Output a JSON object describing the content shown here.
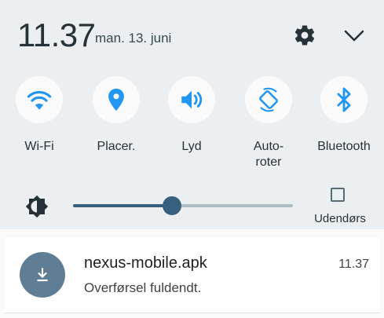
{
  "status": {
    "time": "11.37",
    "date": "man. 13. juni"
  },
  "header": {
    "settings_icon": "gear-icon",
    "expand_icon": "chevron-down-icon"
  },
  "quick_tiles": [
    {
      "label": "Wi-Fi",
      "icon": "wifi-icon"
    },
    {
      "label": "Placer.",
      "icon": "location-icon"
    },
    {
      "label": "Lyd",
      "icon": "volume-icon"
    },
    {
      "label": "Auto-\nroter",
      "icon": "auto-rotate-icon"
    },
    {
      "label": "Bluetooth",
      "icon": "bluetooth-icon"
    }
  ],
  "brightness": {
    "icon": "brightness-icon",
    "level_fraction": 0.45,
    "outdoor_label": "Udendørs",
    "outdoor_checked": false
  },
  "notification": {
    "icon": "download-icon",
    "title": "nexus-mobile.apk",
    "time": "11.37",
    "subtitle": "Overførsel fuldendt."
  },
  "colors": {
    "accent": "#2196f3",
    "slider": "#37607e",
    "panel_bg": "#eceff1"
  }
}
